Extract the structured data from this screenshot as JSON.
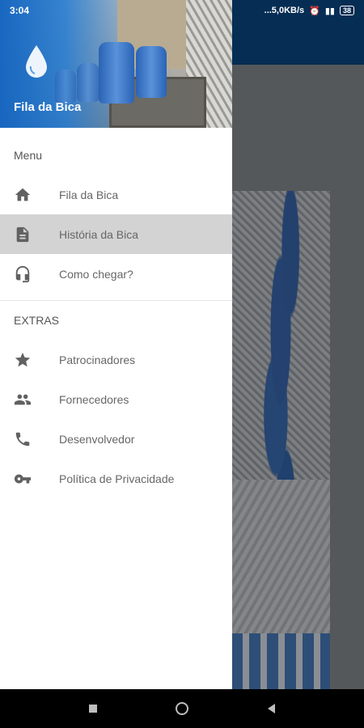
{
  "status_bar": {
    "time": "3:04",
    "network_speed": "...5,0KB/s",
    "battery": "38"
  },
  "drawer": {
    "app_title": "Fila da Bica",
    "sections": [
      {
        "label": "Menu",
        "items": [
          {
            "label": "Fila da Bica",
            "icon": "home-icon",
            "active": false
          },
          {
            "label": "História da Bica",
            "icon": "document-icon",
            "active": true
          },
          {
            "label": "Como chegar?",
            "icon": "headset-icon",
            "active": false
          }
        ]
      },
      {
        "label": "EXTRAS",
        "items": [
          {
            "label": "Patrocinadores",
            "icon": "star-icon",
            "active": false
          },
          {
            "label": "Fornecedores",
            "icon": "people-icon",
            "active": false
          },
          {
            "label": "Desenvolvedor",
            "icon": "phone-icon",
            "active": false
          },
          {
            "label": "Política de Privacidade",
            "icon": "key-icon",
            "active": false
          }
        ]
      }
    ]
  },
  "colors": {
    "accent": "#1565c0",
    "toolbar": "#0b4a86",
    "active_item_bg": "#d3d3d3",
    "icon": "#616161"
  }
}
